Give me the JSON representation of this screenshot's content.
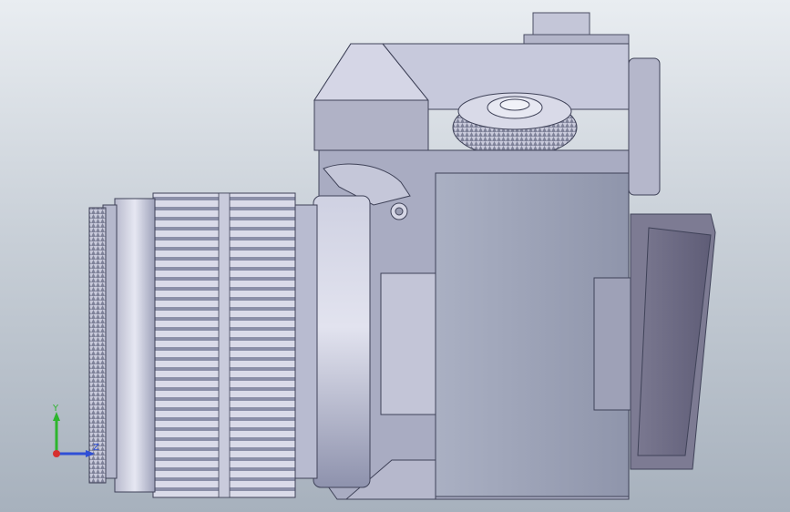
{
  "viewport": {
    "background_top": "#e9edf1",
    "background_bottom": "#a7b1bd",
    "model_color": "#b9b9cc"
  },
  "triad": {
    "y_label": "Y",
    "z_label": "Z",
    "y_color": "#2db52d",
    "z_color": "#2f4fd6",
    "x_color": "#d62f2f"
  }
}
